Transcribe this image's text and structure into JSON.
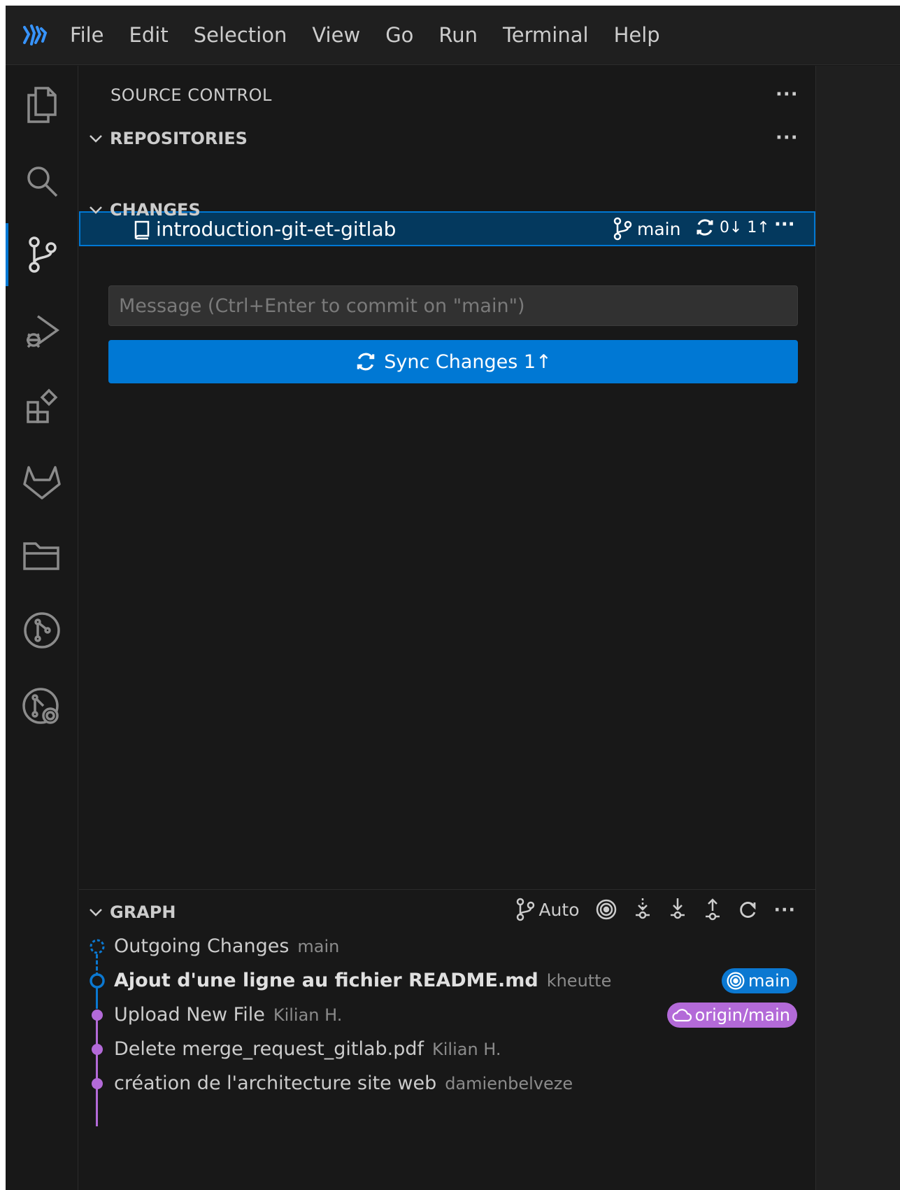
{
  "menu": [
    "File",
    "Edit",
    "Selection",
    "View",
    "Go",
    "Run",
    "Terminal",
    "Help"
  ],
  "sidebar": {
    "title": "SOURCE CONTROL",
    "more": "···"
  },
  "repositories": {
    "header": "REPOSITORIES",
    "more": "···",
    "repo": {
      "name": "introduction-git-et-gitlab",
      "branch": "main",
      "sync": "0↓ 1↑",
      "more": "···"
    }
  },
  "changes": {
    "header": "CHANGES",
    "placeholder": "Message (Ctrl+Enter to commit on \"main\")",
    "sync_button": "Sync Changes 1↑"
  },
  "graph": {
    "header": "GRAPH",
    "auto_label": "Auto",
    "more": "···",
    "commits": [
      {
        "title": "Outgoing Changes",
        "author": "main",
        "bold": false
      },
      {
        "title": "Ajout d'une ligne au fichier README.md",
        "author": "kheutte",
        "bold": true,
        "badge": "main"
      },
      {
        "title": "Upload New File",
        "author": "Kilian H.",
        "bold": false,
        "badge": "origin/main"
      },
      {
        "title": "Delete merge_request_gitlab.pdf",
        "author": "Kilian H.",
        "bold": false
      },
      {
        "title": "création de l'architecture site web",
        "author": "damienbelveze",
        "bold": false
      }
    ]
  },
  "colors": {
    "accent": "#0078d4",
    "selection": "#04395e",
    "remote_badge": "#b36ad8",
    "graph_line": "#b36ad8"
  }
}
